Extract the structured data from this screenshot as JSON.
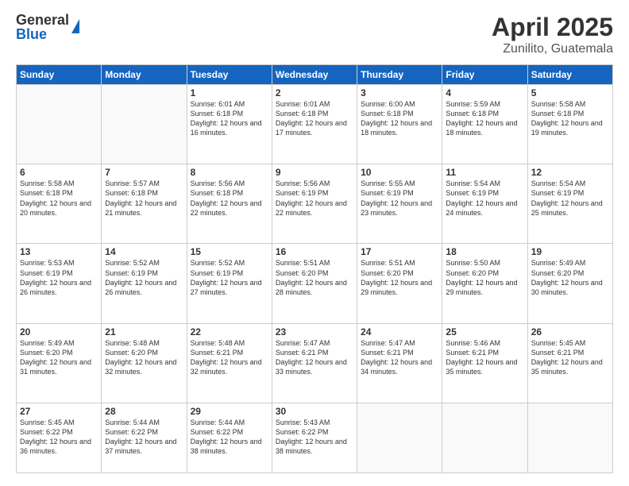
{
  "logo": {
    "general": "General",
    "blue": "Blue"
  },
  "title": "April 2025",
  "subtitle": "Zunilito, Guatemala",
  "weekdays": [
    "Sunday",
    "Monday",
    "Tuesday",
    "Wednesday",
    "Thursday",
    "Friday",
    "Saturday"
  ],
  "weeks": [
    [
      {
        "day": "",
        "info": ""
      },
      {
        "day": "",
        "info": ""
      },
      {
        "day": "1",
        "info": "Sunrise: 6:01 AM\nSunset: 6:18 PM\nDaylight: 12 hours and 16 minutes."
      },
      {
        "day": "2",
        "info": "Sunrise: 6:01 AM\nSunset: 6:18 PM\nDaylight: 12 hours and 17 minutes."
      },
      {
        "day": "3",
        "info": "Sunrise: 6:00 AM\nSunset: 6:18 PM\nDaylight: 12 hours and 18 minutes."
      },
      {
        "day": "4",
        "info": "Sunrise: 5:59 AM\nSunset: 6:18 PM\nDaylight: 12 hours and 18 minutes."
      },
      {
        "day": "5",
        "info": "Sunrise: 5:58 AM\nSunset: 6:18 PM\nDaylight: 12 hours and 19 minutes."
      }
    ],
    [
      {
        "day": "6",
        "info": "Sunrise: 5:58 AM\nSunset: 6:18 PM\nDaylight: 12 hours and 20 minutes."
      },
      {
        "day": "7",
        "info": "Sunrise: 5:57 AM\nSunset: 6:18 PM\nDaylight: 12 hours and 21 minutes."
      },
      {
        "day": "8",
        "info": "Sunrise: 5:56 AM\nSunset: 6:18 PM\nDaylight: 12 hours and 22 minutes."
      },
      {
        "day": "9",
        "info": "Sunrise: 5:56 AM\nSunset: 6:19 PM\nDaylight: 12 hours and 22 minutes."
      },
      {
        "day": "10",
        "info": "Sunrise: 5:55 AM\nSunset: 6:19 PM\nDaylight: 12 hours and 23 minutes."
      },
      {
        "day": "11",
        "info": "Sunrise: 5:54 AM\nSunset: 6:19 PM\nDaylight: 12 hours and 24 minutes."
      },
      {
        "day": "12",
        "info": "Sunrise: 5:54 AM\nSunset: 6:19 PM\nDaylight: 12 hours and 25 minutes."
      }
    ],
    [
      {
        "day": "13",
        "info": "Sunrise: 5:53 AM\nSunset: 6:19 PM\nDaylight: 12 hours and 26 minutes."
      },
      {
        "day": "14",
        "info": "Sunrise: 5:52 AM\nSunset: 6:19 PM\nDaylight: 12 hours and 26 minutes."
      },
      {
        "day": "15",
        "info": "Sunrise: 5:52 AM\nSunset: 6:19 PM\nDaylight: 12 hours and 27 minutes."
      },
      {
        "day": "16",
        "info": "Sunrise: 5:51 AM\nSunset: 6:20 PM\nDaylight: 12 hours and 28 minutes."
      },
      {
        "day": "17",
        "info": "Sunrise: 5:51 AM\nSunset: 6:20 PM\nDaylight: 12 hours and 29 minutes."
      },
      {
        "day": "18",
        "info": "Sunrise: 5:50 AM\nSunset: 6:20 PM\nDaylight: 12 hours and 29 minutes."
      },
      {
        "day": "19",
        "info": "Sunrise: 5:49 AM\nSunset: 6:20 PM\nDaylight: 12 hours and 30 minutes."
      }
    ],
    [
      {
        "day": "20",
        "info": "Sunrise: 5:49 AM\nSunset: 6:20 PM\nDaylight: 12 hours and 31 minutes."
      },
      {
        "day": "21",
        "info": "Sunrise: 5:48 AM\nSunset: 6:20 PM\nDaylight: 12 hours and 32 minutes."
      },
      {
        "day": "22",
        "info": "Sunrise: 5:48 AM\nSunset: 6:21 PM\nDaylight: 12 hours and 32 minutes."
      },
      {
        "day": "23",
        "info": "Sunrise: 5:47 AM\nSunset: 6:21 PM\nDaylight: 12 hours and 33 minutes."
      },
      {
        "day": "24",
        "info": "Sunrise: 5:47 AM\nSunset: 6:21 PM\nDaylight: 12 hours and 34 minutes."
      },
      {
        "day": "25",
        "info": "Sunrise: 5:46 AM\nSunset: 6:21 PM\nDaylight: 12 hours and 35 minutes."
      },
      {
        "day": "26",
        "info": "Sunrise: 5:45 AM\nSunset: 6:21 PM\nDaylight: 12 hours and 35 minutes."
      }
    ],
    [
      {
        "day": "27",
        "info": "Sunrise: 5:45 AM\nSunset: 6:22 PM\nDaylight: 12 hours and 36 minutes."
      },
      {
        "day": "28",
        "info": "Sunrise: 5:44 AM\nSunset: 6:22 PM\nDaylight: 12 hours and 37 minutes."
      },
      {
        "day": "29",
        "info": "Sunrise: 5:44 AM\nSunset: 6:22 PM\nDaylight: 12 hours and 38 minutes."
      },
      {
        "day": "30",
        "info": "Sunrise: 5:43 AM\nSunset: 6:22 PM\nDaylight: 12 hours and 38 minutes."
      },
      {
        "day": "",
        "info": ""
      },
      {
        "day": "",
        "info": ""
      },
      {
        "day": "",
        "info": ""
      }
    ]
  ]
}
